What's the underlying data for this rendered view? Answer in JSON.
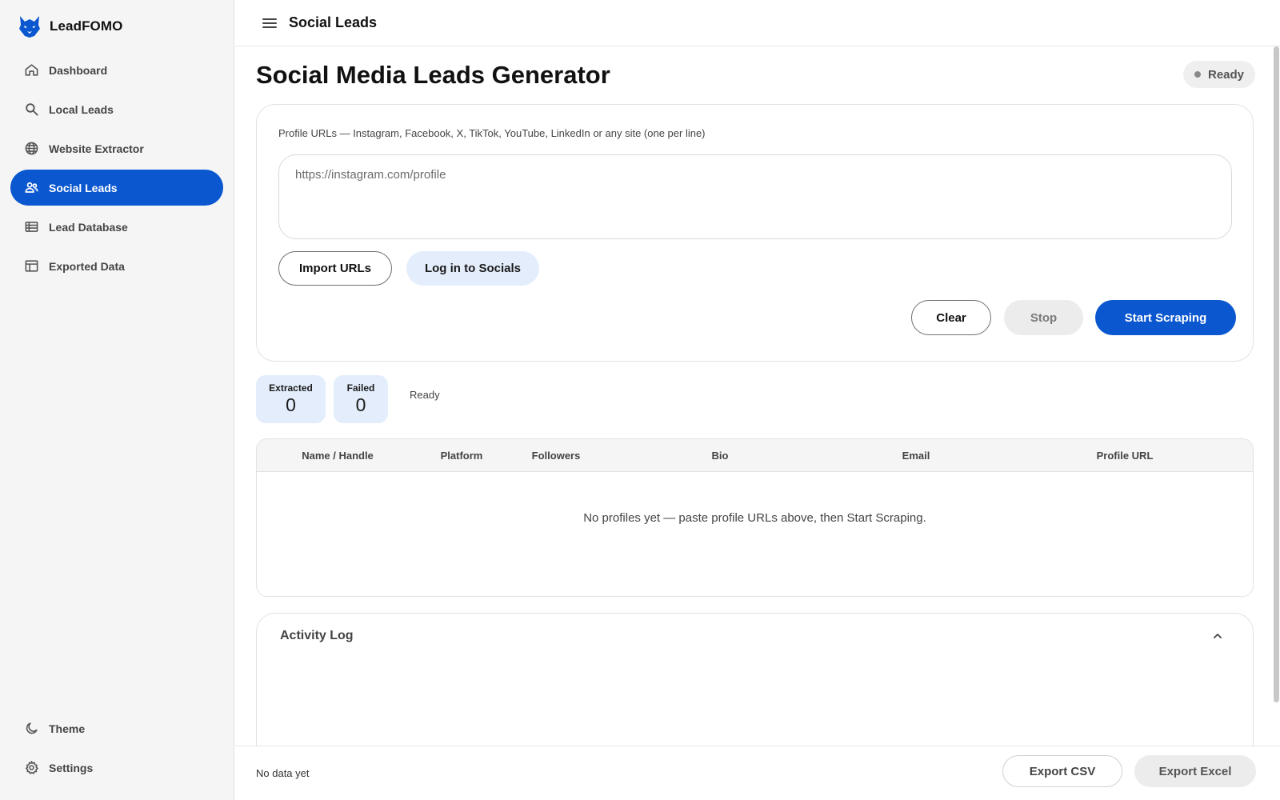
{
  "app": {
    "name": "LeadFOMO"
  },
  "sidebar": {
    "items": [
      {
        "label": "Dashboard",
        "icon": "home-icon",
        "active": false
      },
      {
        "label": "Local Leads",
        "icon": "search-icon",
        "active": false
      },
      {
        "label": "Website Extractor",
        "icon": "globe-icon",
        "active": false
      },
      {
        "label": "Social Leads",
        "icon": "people-icon",
        "active": true
      },
      {
        "label": "Lead Database",
        "icon": "list-icon",
        "active": false
      },
      {
        "label": "Exported Data",
        "icon": "table-icon",
        "active": false
      }
    ],
    "bottom": [
      {
        "label": "Theme",
        "icon": "moon-icon"
      },
      {
        "label": "Settings",
        "icon": "gear-icon"
      }
    ]
  },
  "topbar": {
    "title": "Social Leads"
  },
  "page": {
    "title": "Social Media Leads Generator",
    "status": "Ready"
  },
  "input_card": {
    "label": "Profile URLs — Instagram, Facebook, X, TikTok, YouTube, LinkedIn or any site (one per line)",
    "placeholder": "https://instagram.com/profile",
    "import_label": "Import URLs",
    "login_label": "Log in to Socials",
    "clear_label": "Clear",
    "stop_label": "Stop",
    "start_label": "Start Scraping"
  },
  "stats": {
    "extracted_label": "Extracted",
    "extracted_value": "0",
    "failed_label": "Failed",
    "failed_value": "0",
    "status_text": "Ready"
  },
  "table": {
    "columns": [
      "Name / Handle",
      "Platform",
      "Followers",
      "Bio",
      "Email",
      "Profile URL"
    ],
    "empty_message": "No profiles yet — paste profile URLs above, then Start Scraping."
  },
  "activity_log": {
    "title": "Activity Log"
  },
  "footer": {
    "status": "No data yet",
    "export_csv": "Export CSV",
    "export_excel": "Export Excel"
  },
  "colors": {
    "primary": "#0b57d0",
    "tonal": "#e3edfb",
    "sidebar_bg": "#f5f5f5"
  }
}
